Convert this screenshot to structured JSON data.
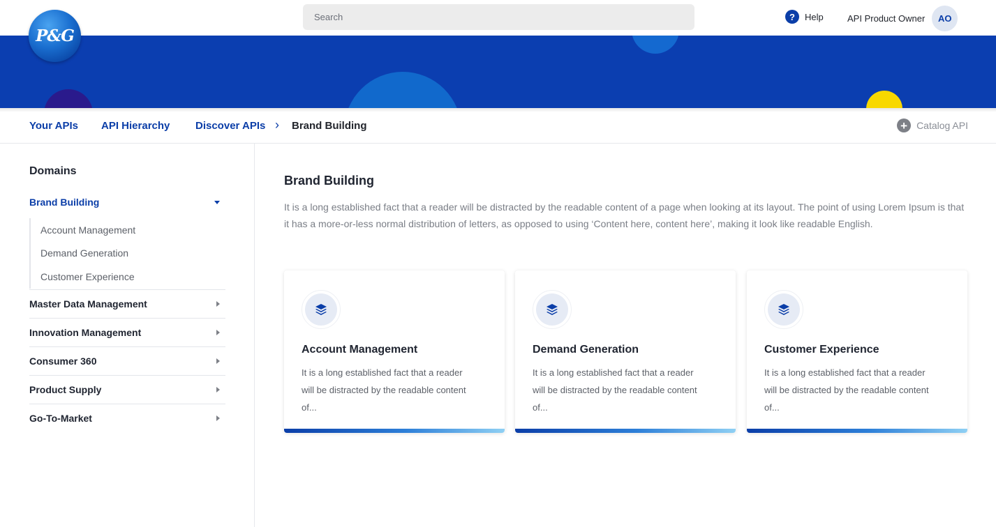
{
  "header": {
    "logo_text": "P&G",
    "search_placeholder": "Search",
    "help_label": "Help",
    "user_role": "API Product Owner",
    "user_initials": "AO"
  },
  "nav": {
    "links": [
      "Your APIs",
      "API Hierarchy",
      "Discover APIs"
    ],
    "breadcrumb_current": "Brand Building",
    "catalog_label": "Catalog API"
  },
  "sidebar": {
    "title": "Domains",
    "active_domain": "Brand Building",
    "sub_items": [
      "Account Management",
      "Demand Generation",
      "Customer Experience"
    ],
    "domains": [
      "Master Data Management",
      "Innovation Management",
      "Consumer 360",
      "Product Supply",
      "Go-To-Market"
    ]
  },
  "main": {
    "title": "Brand Building",
    "description": "It is a long established fact that a reader will be distracted by the readable content of a page when looking at its layout. The point of using Lorem Ipsum is that it has a more-or-less normal distribution of letters, as opposed to using ‘Content here, content here’, making it look like readable English.",
    "cards": [
      {
        "title": "Account Management",
        "description": "It is a long established fact that a reader will be distracted by the readable content of...",
        "icon": "layers-icon"
      },
      {
        "title": "Demand Generation",
        "description": "It is a long established fact that a reader will be distracted by the readable content of...",
        "icon": "layers-icon"
      },
      {
        "title": "Customer Experience",
        "description": "It is a long established fact that a reader will be distracted by the readable content of...",
        "icon": "layers-icon"
      }
    ]
  },
  "colors": {
    "brand_blue": "#0b3ea8",
    "banner_blue": "#0b3eb0",
    "accent_yellow": "#f8d800"
  }
}
